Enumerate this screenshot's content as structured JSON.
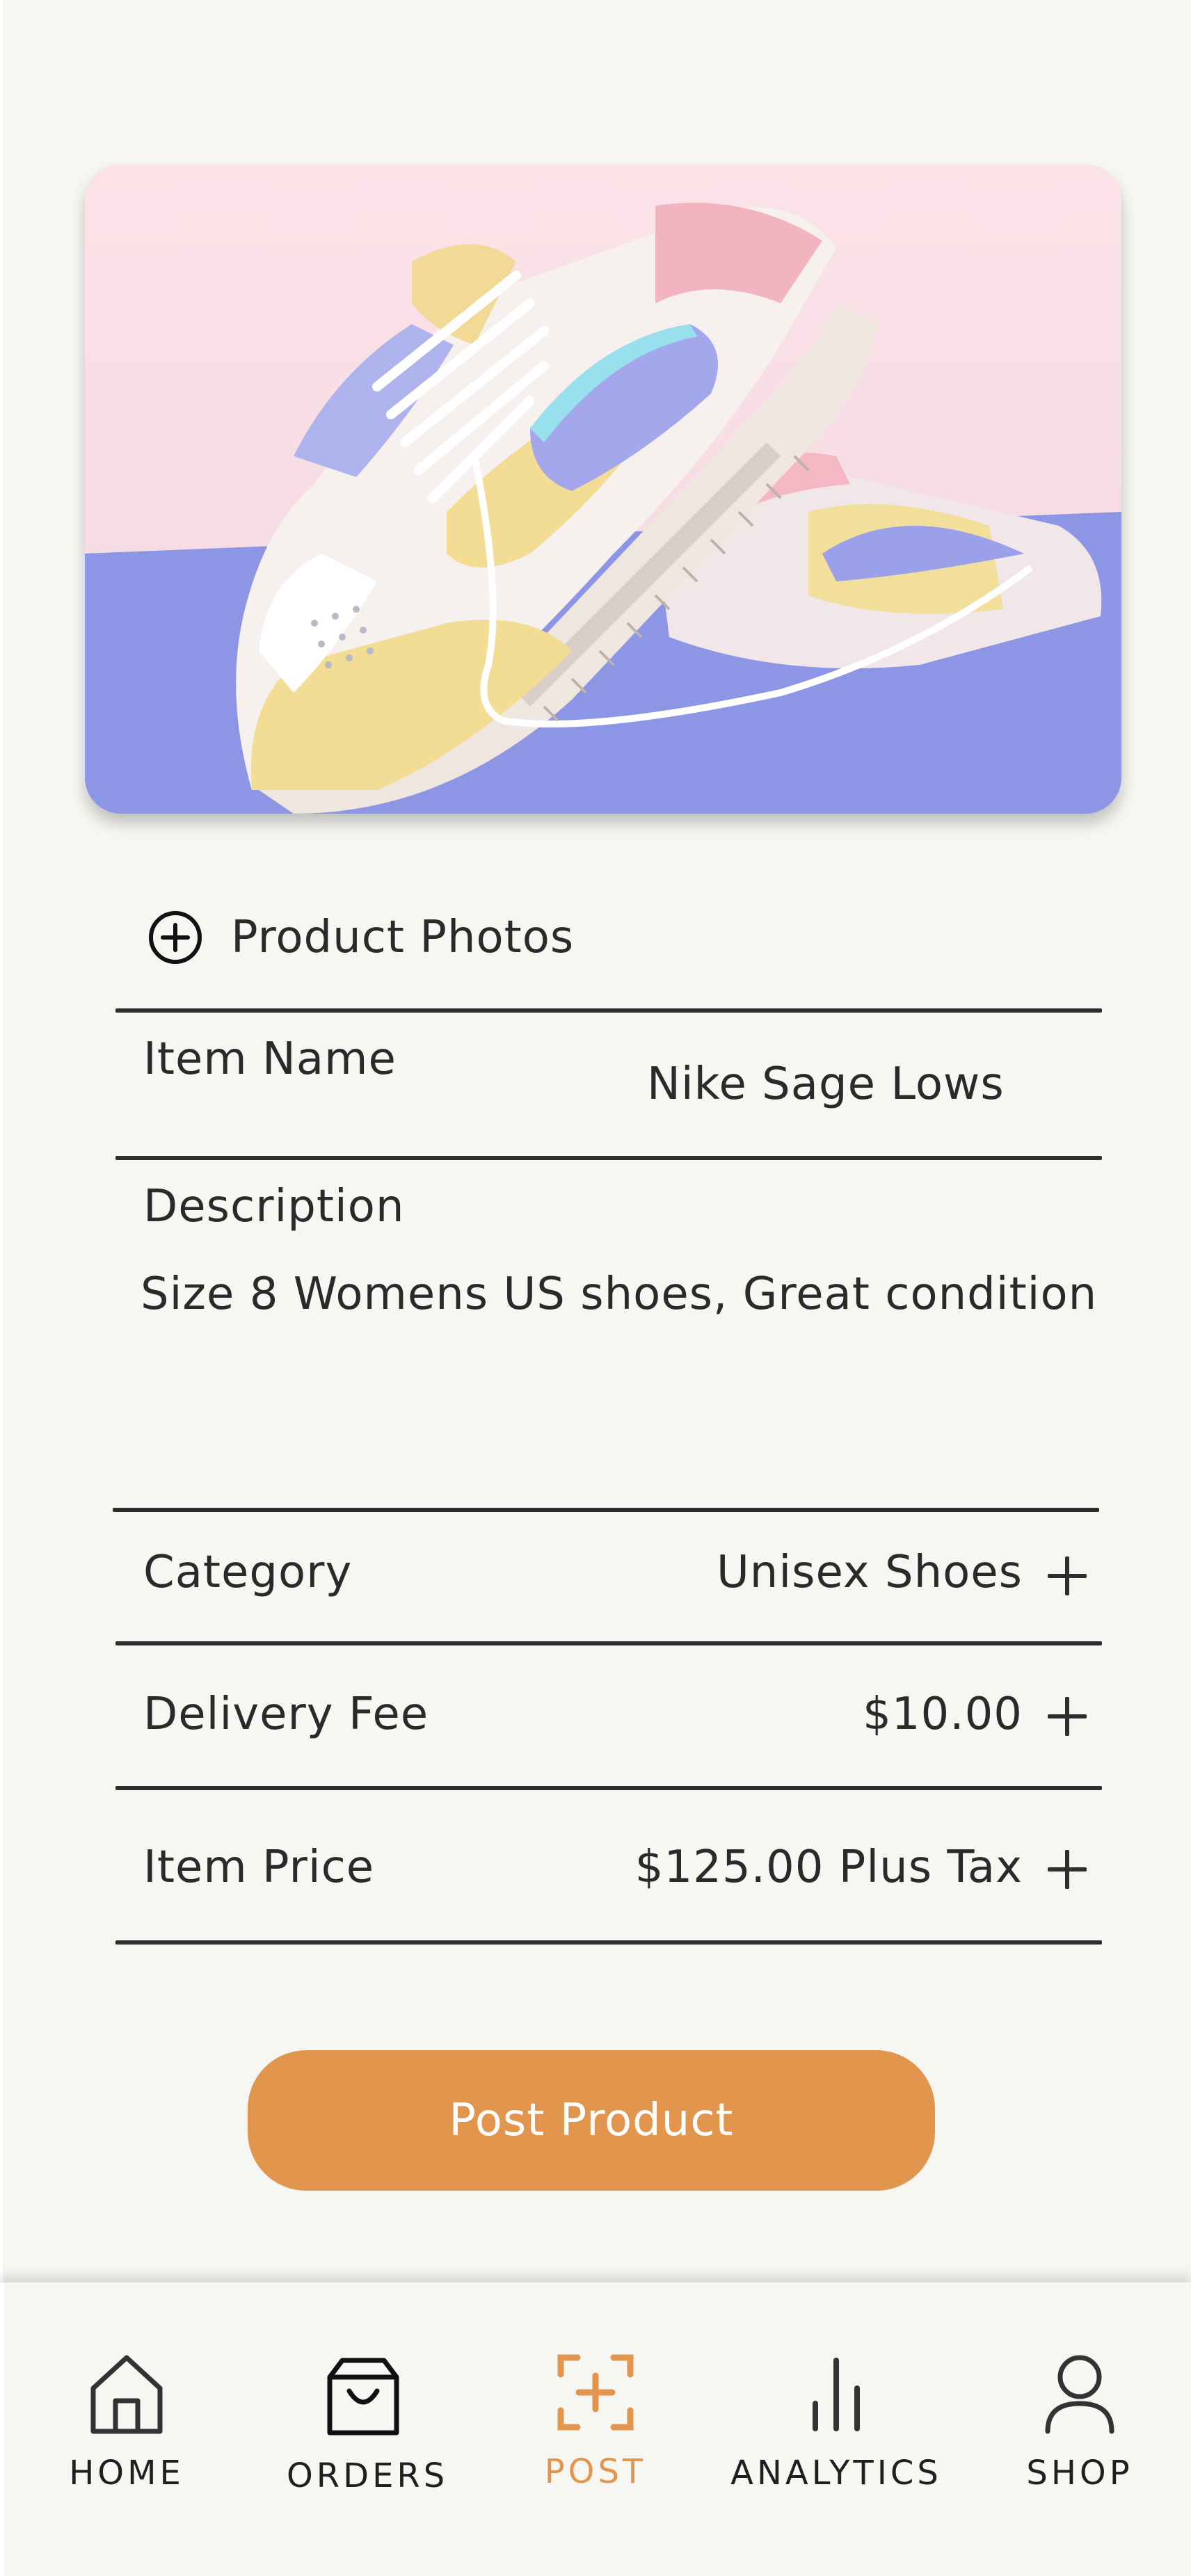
{
  "product_image": {
    "alt": "Pastel Nike sneakers"
  },
  "photos": {
    "add_label": "Product Photos",
    "icon": "plus-circle-icon"
  },
  "form": {
    "item_name": {
      "label": "Item Name",
      "value": "Nike Sage Lows"
    },
    "description": {
      "label": "Description",
      "value": "Size 8 Womens US shoes, Great condition"
    },
    "category": {
      "label": "Category",
      "value": "Unisex Shoes"
    },
    "delivery_fee": {
      "label": "Delivery Fee",
      "value": "$10.00"
    },
    "item_price": {
      "label": "Item Price",
      "value": "$125.00 Plus Tax"
    }
  },
  "actions": {
    "post_label": "Post Product"
  },
  "nav": {
    "items": [
      {
        "label": "HOME",
        "icon": "home-icon"
      },
      {
        "label": "ORDERS",
        "icon": "shopping-bag-icon"
      },
      {
        "label": "POST",
        "icon": "add-post-icon",
        "active": true
      },
      {
        "label": "ANALYTICS",
        "icon": "bar-chart-icon"
      },
      {
        "label": "SHOP",
        "icon": "user-icon"
      }
    ]
  },
  "colors": {
    "accent": "#e2964d",
    "background": "#f6f6f3",
    "text": "#2b2b2b"
  }
}
